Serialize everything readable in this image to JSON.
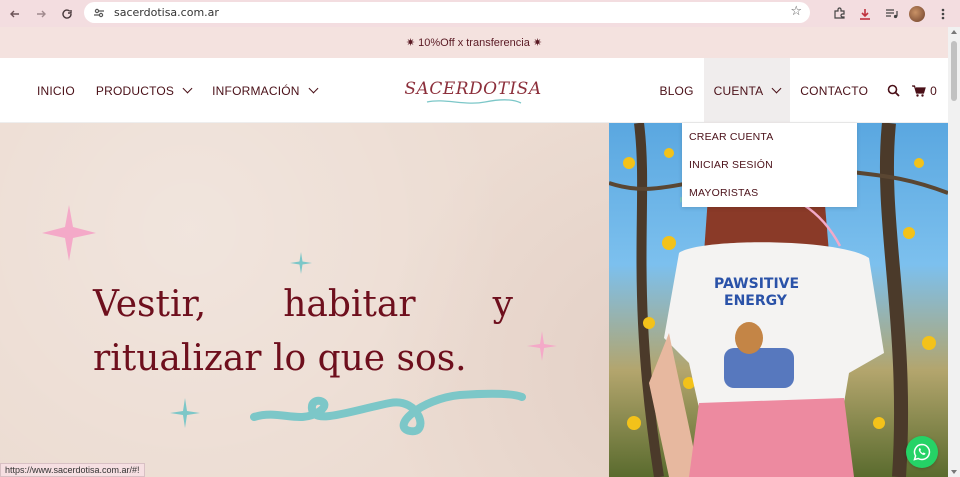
{
  "browser": {
    "url": "sacerdotisa.com.ar"
  },
  "promo": {
    "text": "✷ 10%Off x transferencia ✷"
  },
  "nav": {
    "left": [
      {
        "label": "INICIO",
        "has_dropdown": false
      },
      {
        "label": "PRODUCTOS",
        "has_dropdown": true
      },
      {
        "label": "INFORMACIÓN",
        "has_dropdown": true
      }
    ],
    "logo_text": "SACERDOTISA",
    "blog": "BLOG",
    "cuenta": "CUENTA",
    "contacto": "CONTACTO",
    "cart_count": "0"
  },
  "dropdown": {
    "items": [
      "CREAR CUENTA",
      "INICIAR SESIÓN",
      "MAYORISTAS"
    ]
  },
  "hero": {
    "line1_words": [
      "Vestir,",
      "habitar",
      "y"
    ],
    "line2": "ritualizar lo que sos.",
    "photo_tshirt_text": "PAWSITIVE ENERGY"
  },
  "status_url": "https://www.sacerdotisa.com.ar/#!",
  "colors": {
    "brand_maroon": "#6e0f1d",
    "promo_bg": "#f4e2df",
    "hero_bg": "#ecdcd2",
    "accent_teal": "#7cc7c8",
    "accent_pink": "#f2a9c9",
    "whatsapp": "#25d366"
  }
}
